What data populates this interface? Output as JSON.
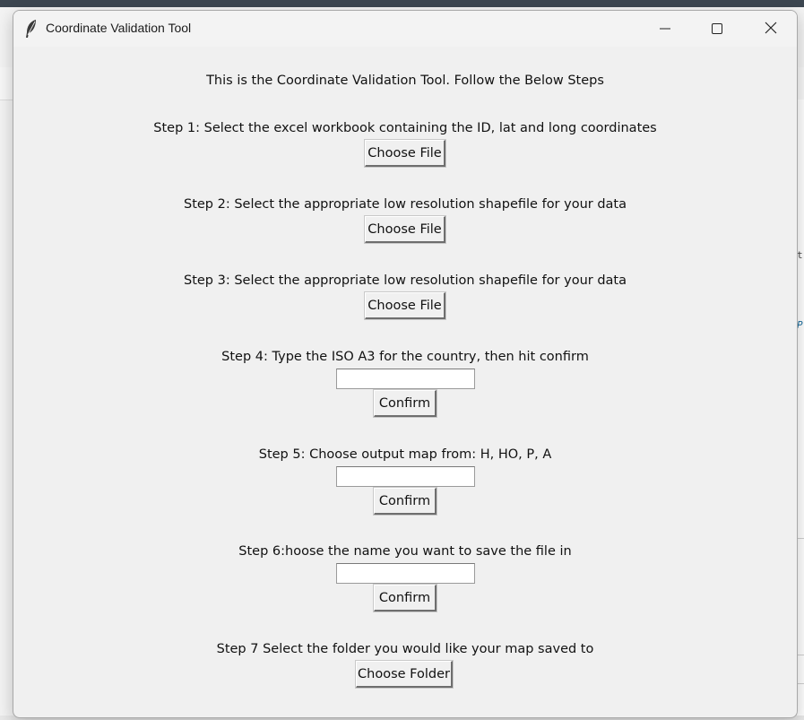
{
  "window": {
    "title": "Coordinate Validation Tool",
    "controls": {
      "minimize": "minimize-icon",
      "maximize": "maximize-icon",
      "close": "close-icon"
    }
  },
  "intro": "This is the Coordinate Validation Tool. Follow the Below Steps",
  "steps": [
    {
      "label": "Step 1: Select the excel workbook containing the ID, lat and long coordinates",
      "button": "Choose File"
    },
    {
      "label": "Step 2: Select the appropriate low resolution shapefile for your data",
      "button": "Choose File"
    },
    {
      "label": "Step 3: Select the appropriate low resolution shapefile for your data",
      "button": "Choose File"
    },
    {
      "label": "Step 4: Type the ISO A3 for the country, then hit confirm",
      "input_value": "",
      "button": "Confirm"
    },
    {
      "label": "Step 5: Choose output map from: H, HO, P, A",
      "input_value": "",
      "button": "Confirm"
    },
    {
      "label": "Step 6:hoose the name you want to save the file in",
      "input_value": "",
      "button": "Confirm"
    },
    {
      "label": "Step 7 Select the folder you would like your map saved to",
      "button": "Choose Folder"
    }
  ],
  "background_app": {
    "glyph_1": "t",
    "glyph_2": "P"
  }
}
